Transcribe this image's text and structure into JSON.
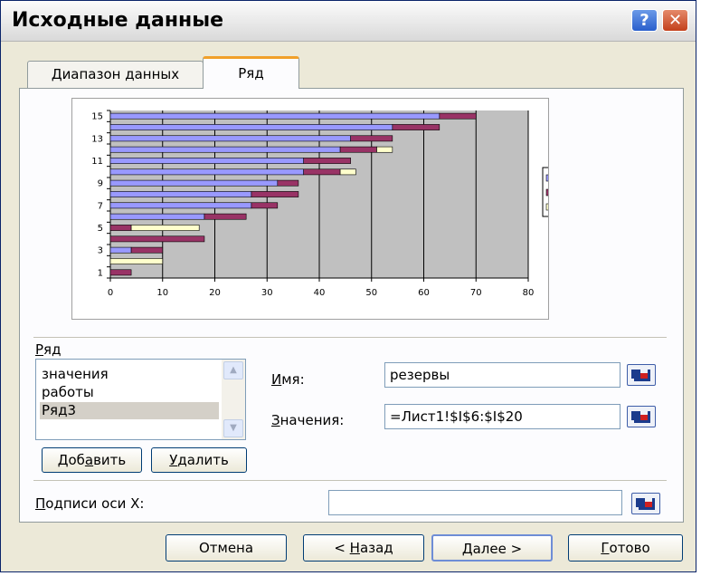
{
  "dialog": {
    "title": "Исходные данные",
    "help_glyph": "?",
    "close_glyph": "✕"
  },
  "tabs": [
    {
      "label": "Диапазон данных",
      "active": false
    },
    {
      "label": "Ряд",
      "active": true
    }
  ],
  "chart_data": {
    "type": "bar",
    "orientation": "horizontal",
    "stacked": true,
    "categories": [
      "1",
      "2",
      "3",
      "4",
      "5",
      "6",
      "7",
      "8",
      "9",
      "10",
      "11",
      "12",
      "13",
      "14",
      "15"
    ],
    "y_tick_labels": [
      "1",
      "3",
      "5",
      "7",
      "9",
      "11",
      "13",
      "15"
    ],
    "x_tick_labels": [
      "0",
      "10",
      "20",
      "30",
      "40",
      "50",
      "60",
      "70",
      "80"
    ],
    "xlim": [
      0,
      80
    ],
    "grid": true,
    "legend_position": "right",
    "series": [
      {
        "name": "значения",
        "color": "#9999ff",
        "values": [
          0,
          0,
          4,
          0,
          0,
          18,
          27,
          27,
          32,
          37,
          37,
          44,
          46,
          54,
          63
        ]
      },
      {
        "name": "работы",
        "color": "#993366",
        "values": [
          4,
          0,
          6,
          18,
          4,
          8,
          5,
          9,
          4,
          7,
          9,
          7,
          8,
          9,
          7
        ]
      },
      {
        "name": "Ряд3",
        "color": "#ffffcc",
        "values": [
          0,
          10,
          0,
          0,
          13,
          0,
          0,
          0,
          0,
          3,
          0,
          3,
          0,
          0,
          0
        ]
      }
    ]
  },
  "series_section": {
    "label_prefix": "",
    "label_underlined": "Р",
    "label_rest": "яд",
    "items": [
      "значения",
      "работы",
      "Ряд3"
    ],
    "selected_index": 2,
    "scroll_up_glyph": "▲",
    "scroll_down_glyph": "▼",
    "add_button": {
      "prefix": "Доб",
      "underlined": "а",
      "rest": "вить"
    },
    "remove_button": {
      "prefix": "",
      "underlined": "У",
      "rest": "далить"
    }
  },
  "fields": {
    "name": {
      "prefix": "",
      "underlined": "И",
      "rest": "мя:",
      "value": "резервы"
    },
    "values": {
      "prefix": "",
      "underlined": "З",
      "rest": "начения:",
      "value": "=Лист1!$I$6:$I$20"
    },
    "x_axis_labels": {
      "prefix": "",
      "underlined": "П",
      "rest": "одписи оси X:",
      "value": ""
    }
  },
  "footer": {
    "cancel": {
      "prefix": "Отмена",
      "underlined": "",
      "rest": ""
    },
    "back": {
      "prefix": "< ",
      "underlined": "Н",
      "rest": "азад"
    },
    "next": {
      "prefix": "",
      "underlined": "Д",
      "rest": "алее >"
    },
    "finish": {
      "prefix": "",
      "underlined": "Г",
      "rest": "отово"
    }
  }
}
